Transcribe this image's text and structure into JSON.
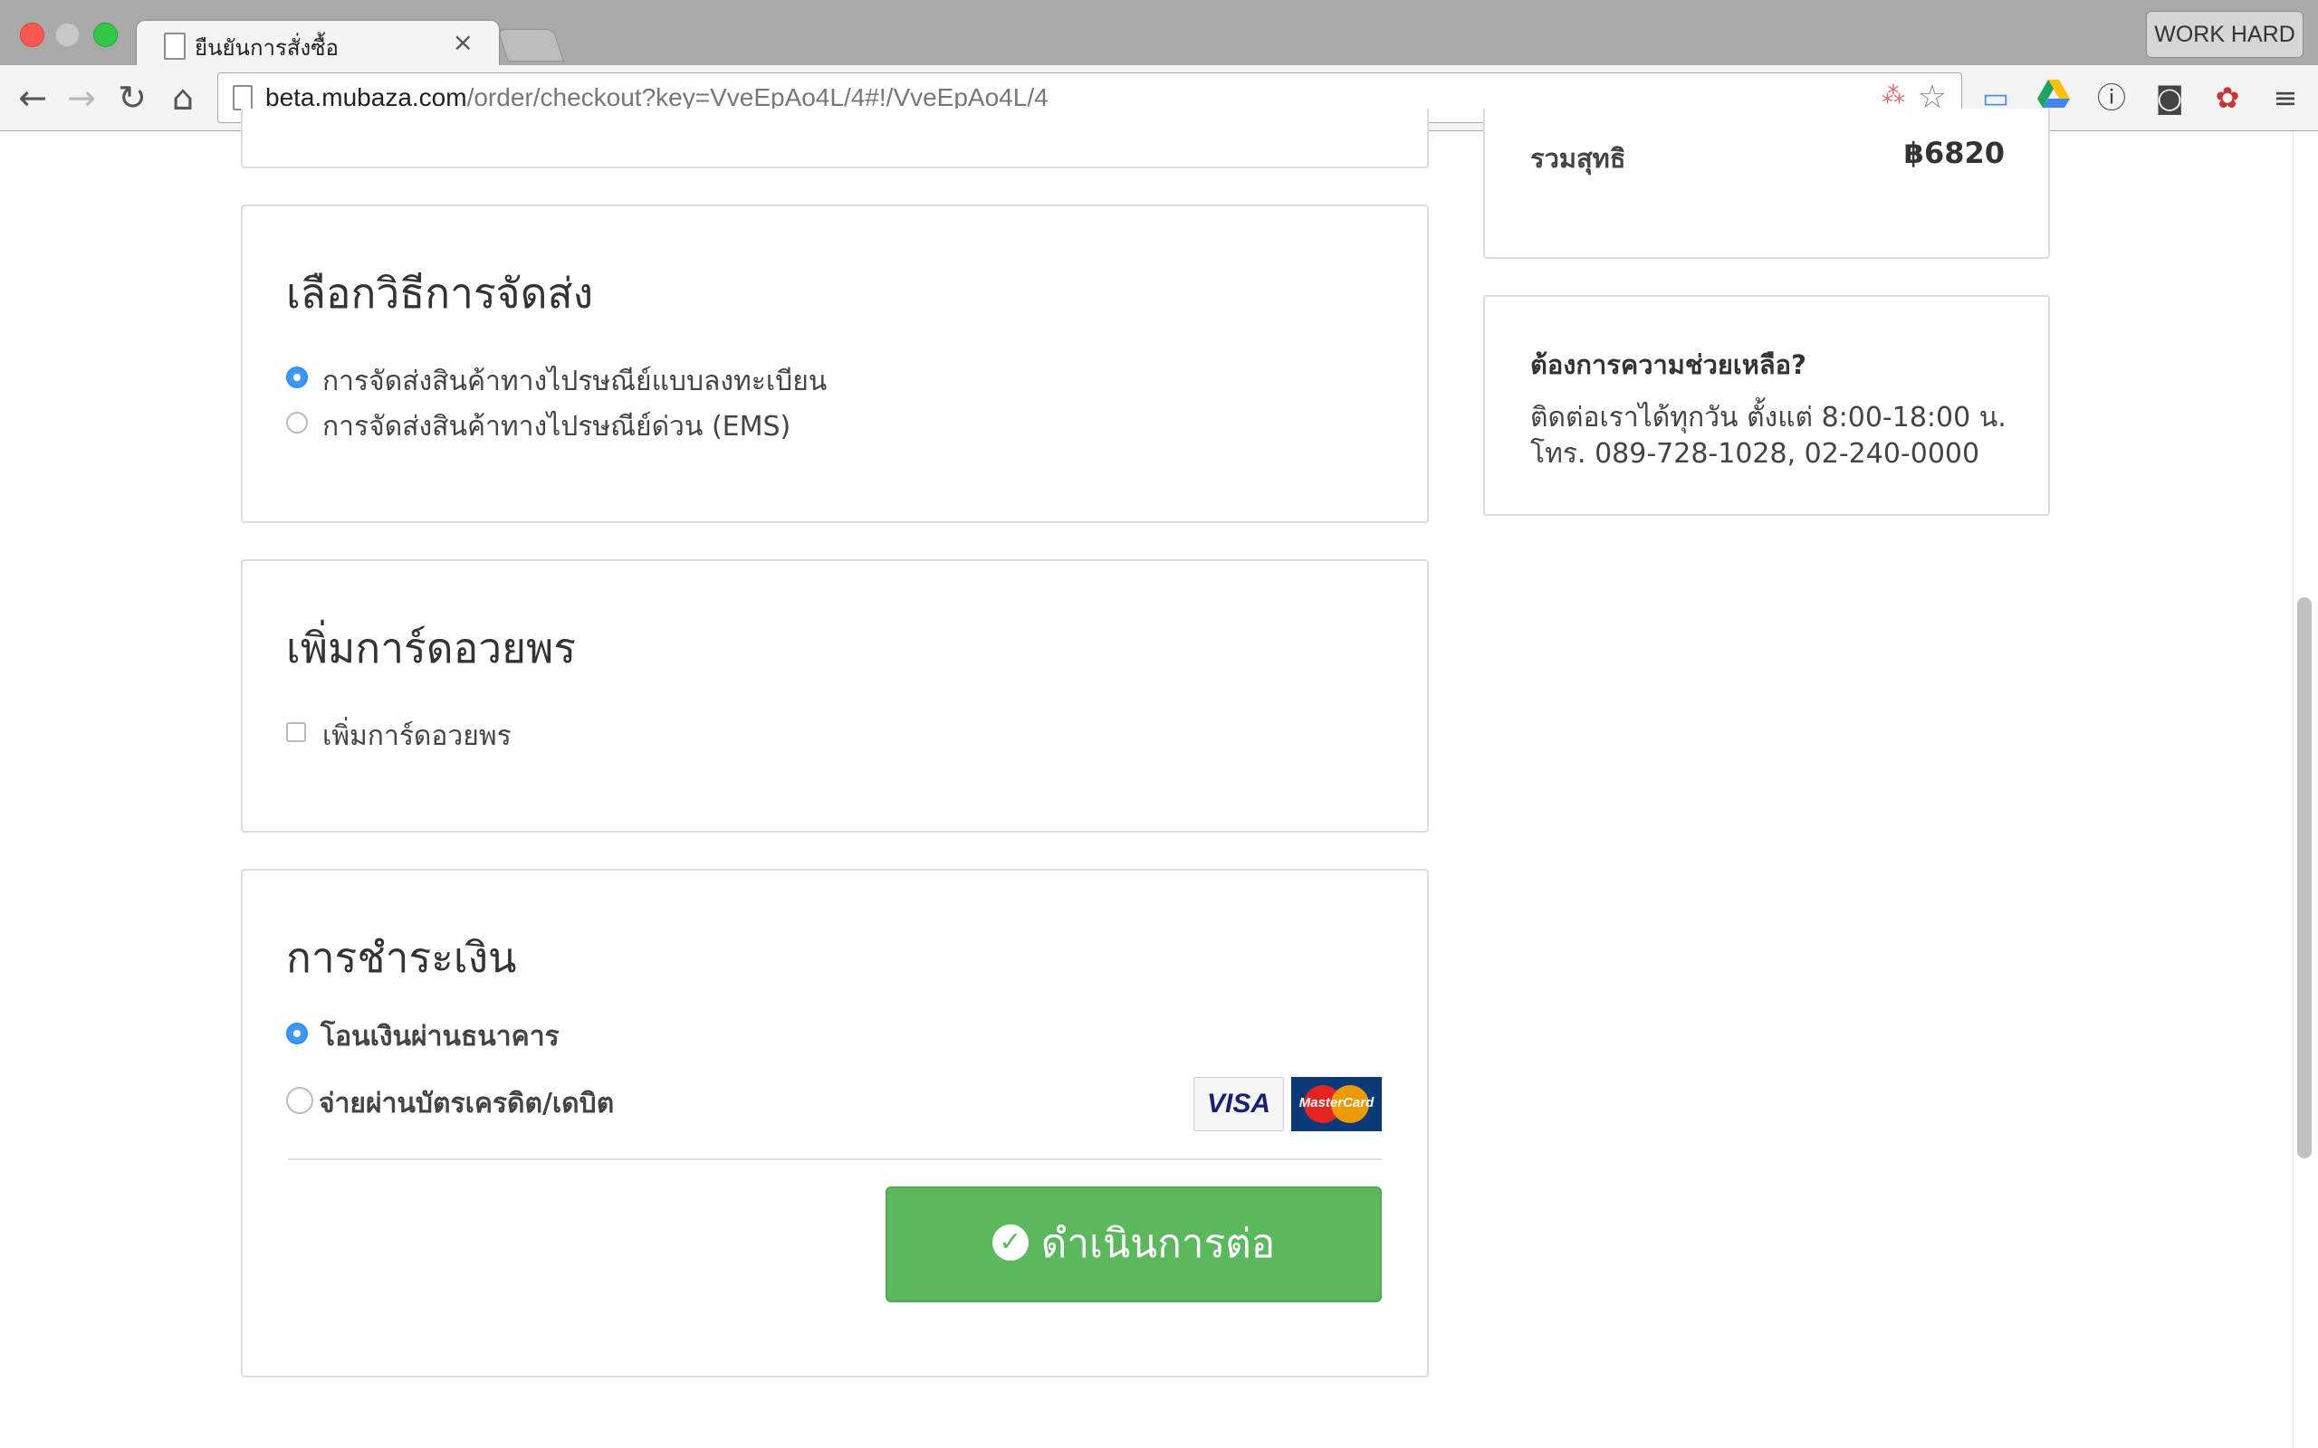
{
  "browser": {
    "tab_title": "ยืนยันการสั่งซื้อ",
    "tab_close": "×",
    "profile_label": "WORK HARD",
    "url_host": "beta.mubaza.com",
    "url_path": "/order/checkout?key=VveEpAo4L/4#!/VveEpAo4L/4",
    "back_icon": "←",
    "forward_icon": "→",
    "reload_icon": "↻",
    "home_icon": "⌂",
    "star_icon": "☆",
    "menu_icon": "≡"
  },
  "summary": {
    "net_label": "รวมสุทธิ",
    "net_value": "฿6820"
  },
  "help": {
    "title": "ต้องการความช่วยเหลือ?",
    "hours": "ติดต่อเราได้ทุกวัน ตั้งแต่ 8:00-18:00 น.",
    "phone": "โทร. 089-728-1028, 02-240-0000"
  },
  "shipping": {
    "title": "เลือกวิธีการจัดส่ง",
    "options": [
      {
        "label": "การจัดส่งสินค้าทางไปรษณีย์แบบลงทะเบียน",
        "selected": true
      },
      {
        "label": "การจัดส่งสินค้าทางไปรษณีย์ด่วน (EMS)",
        "selected": false
      }
    ]
  },
  "greeting_card": {
    "title": "เพิ่มการ์ดอวยพร",
    "checkbox_label": "เพิ่มการ์ดอวยพร",
    "checked": false
  },
  "payment": {
    "title": "การชำระเงิน",
    "options": [
      {
        "label": "โอนเงินผ่านธนาคาร",
        "selected": true
      },
      {
        "label": "จ่ายผ่านบัตรเครดิต/เดบิต",
        "selected": false
      }
    ],
    "card_logos": [
      "VISA",
      "MasterCard"
    ],
    "continue_label": "ดำเนินการต่อ",
    "continue_icon": "✓"
  },
  "colors": {
    "accent": "#3d97f5",
    "button": "#5cb85c"
  }
}
